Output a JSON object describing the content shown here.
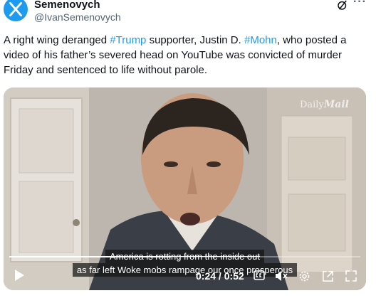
{
  "author": {
    "name": "Semenovych",
    "handle": "@IvanSemenovych",
    "avatar_color": "#1d9bf0"
  },
  "tweet": {
    "part1": "A right wing deranged ",
    "tag1": "#Trump",
    "part2": " supporter, Justin D. ",
    "tag2": "#Mohn",
    "part3": ", who posted a video of his father’s severed head on YouTube was convicted of murder Friday and sentenced to life without parole.",
    "hashtag_color": "#1d9bf0"
  },
  "video": {
    "watermark_regular": "Daily",
    "watermark_bold": "Mail",
    "caption_line1": "America is rotting from the inside out",
    "caption_line2": "as far left Woke mobs rampage our once prosperous",
    "time_display": "0:24 / 0:52",
    "progress": 0.46
  },
  "icons": {
    "more": "more-icon",
    "grok": "grok-icon",
    "play": "play-icon",
    "cc": "captions-icon",
    "mute": "mute-icon",
    "settings": "gear-icon",
    "popout": "popout-icon",
    "fullscreen": "fullscreen-icon"
  }
}
